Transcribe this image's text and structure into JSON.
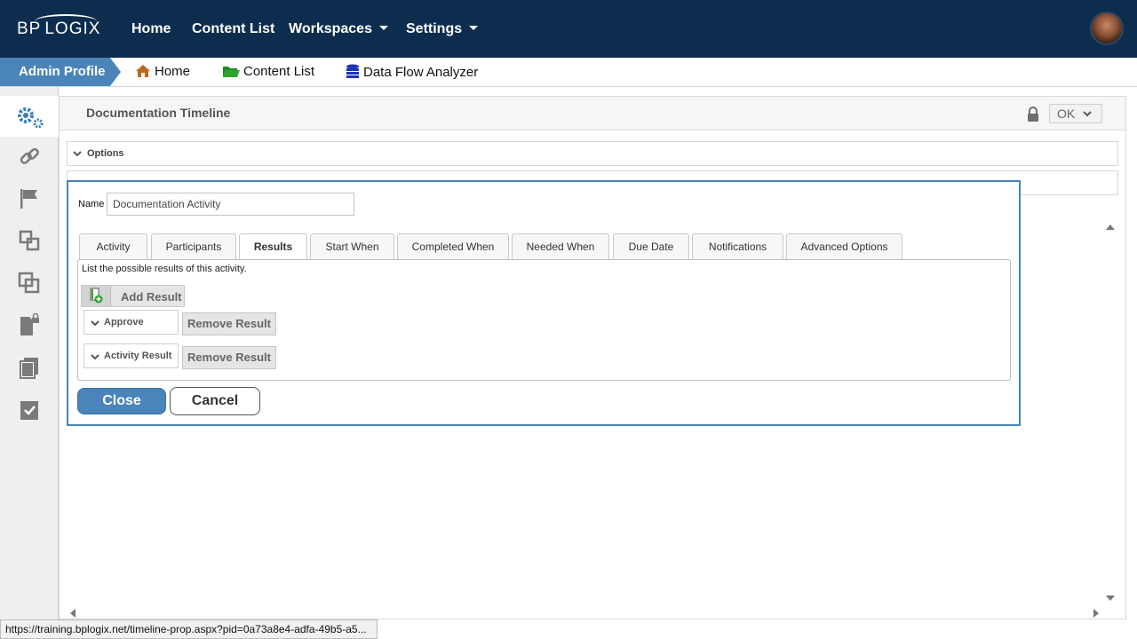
{
  "header": {
    "logo_left": "BP",
    "logo_right": "LOGIX",
    "nav": [
      "Home",
      "Content List",
      "Workspaces",
      "Settings"
    ]
  },
  "breadcrumb": {
    "profile": "Admin Profile",
    "items": [
      "Home",
      "Content List",
      "Data Flow Analyzer"
    ]
  },
  "sidebar": {
    "icons": [
      "gears-icon",
      "link-icon",
      "flag-icon",
      "group-icon",
      "layers-icon",
      "locked-document-icon",
      "copy-icon",
      "checklist-icon"
    ]
  },
  "panel": {
    "title": "Documentation Timeline",
    "ok_label": "OK",
    "sections": [
      "Options"
    ]
  },
  "dialog": {
    "name_label": "Name",
    "name_value": "Documentation Activity",
    "tabs": [
      "Activity",
      "Participants",
      "Results",
      "Start When",
      "Completed When",
      "Needed When",
      "Due Date",
      "Notifications",
      "Advanced Options"
    ],
    "active_tab": "Results",
    "description": "List the possible results of this activity.",
    "add_result_label": "Add Result",
    "results": [
      "Approve",
      "Activity Result"
    ],
    "remove_result_label": "Remove Result",
    "close_label": "Close",
    "cancel_label": "Cancel"
  },
  "status_url": "https://training.bplogix.net/timeline-prop.aspx?pid=0a73a8e4-adfa-49b5-a5...",
  "colors": {
    "header_bg": "#0d2d4e",
    "accent": "#4a84b8"
  }
}
